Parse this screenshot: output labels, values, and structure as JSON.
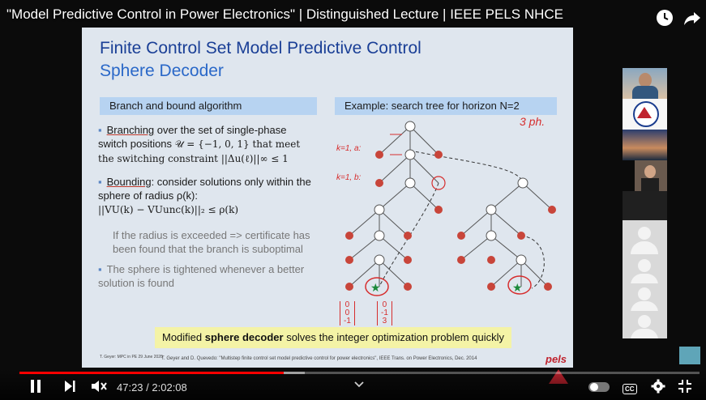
{
  "video": {
    "title": "\"Model Predictive Control in Power Electronics\" | Distinguished Lecture | IEEE PELS NHCE",
    "current_time": "47:23",
    "duration": "2:02:08",
    "progress": 0.388,
    "buffered": 0.42
  },
  "slide": {
    "title": "Finite Control Set Model Predictive Control",
    "subtitle": "Sphere Decoder",
    "left_header": "Branch and bound algorithm",
    "right_header": "Example: search tree for horizon N=2",
    "bullets": [
      {
        "lead": "Branching",
        "text": " over the set of single-phase switch positions",
        "math": "𝒰 = {−1, 0, 1} that meet the switching constraint ||Δu(ℓ)||∞ ≤ 1"
      },
      {
        "lead": "Bounding",
        "text": ": consider solutions only within the sphere of radius ρ(k):",
        "math": "||VU(k) − VUunc(k)||₂ ≤ ρ(k)"
      }
    ],
    "note": "If the radius is exceeded => certificate has been found that the branch is suboptimal",
    "bullet3": "The sphere is tightened whenever a better solution is found",
    "banner_pre": "Modified ",
    "banner_bold": "sphere decoder",
    "banner_post": " solves the integer optimization problem quickly",
    "footer_left": "T. Geyer: MPC in PE\n29 June 2020",
    "footer_citation": "T. Geyer and D. Quevedo: \"Multistep finite control set model predictive control for power electronics\", IEEE Trans. on Power Electronics, Dec. 2014",
    "logo": "pels",
    "handwritten": {
      "phase": "3 ph.",
      "k_a": "k=1, a:",
      "k_b": "k=1, b:",
      "vec1": [
        "0",
        "0",
        "-1"
      ],
      "vec2": [
        "0",
        "-1",
        "3"
      ]
    }
  },
  "colors": {
    "accent_red": "#ff0000",
    "slide_bg": "#dfe6ee",
    "header_blue": "#b7d3f1",
    "banner_yellow": "#f4f3a6"
  },
  "participants": [
    {
      "kind": "person"
    },
    {
      "kind": "logo"
    },
    {
      "kind": "landscape"
    },
    {
      "kind": "person"
    },
    {
      "kind": "dark"
    },
    {
      "kind": "avatar"
    },
    {
      "kind": "avatar"
    },
    {
      "kind": "avatar"
    },
    {
      "kind": "avatar"
    }
  ],
  "icons": [
    "clock-icon",
    "share-icon",
    "pause-icon",
    "next-icon",
    "mute-icon",
    "chevron-down-icon",
    "autoplay-toggle",
    "cc-icon",
    "gear-icon",
    "fullscreen-exit-icon"
  ]
}
